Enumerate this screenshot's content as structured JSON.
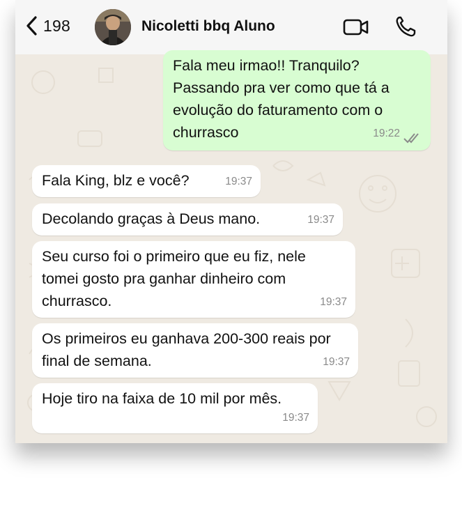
{
  "header": {
    "back_count": "198",
    "contact_name": "Nicoletti bbq Aluno"
  },
  "messages": [
    {
      "direction": "outgoing",
      "text": "Fala meu irmao!! Tranquilo? Passando pra ver como que tá a evolução do faturamento com o churrasco",
      "time": "19:22",
      "status": "read"
    },
    {
      "direction": "incoming",
      "text": "Fala King, blz e você?",
      "time": "19:37"
    },
    {
      "direction": "incoming",
      "text": "Decolando graças à Deus mano.",
      "time": "19:37"
    },
    {
      "direction": "incoming",
      "text": "Seu curso foi o primeiro que eu fiz, nele tomei gosto pra ganhar dinheiro com churrasco.",
      "time": "19:37"
    },
    {
      "direction": "incoming",
      "text": "Os primeiros eu ganhava 200-300 reais por final de semana.",
      "time": "19:37"
    },
    {
      "direction": "incoming",
      "text": "Hoje tiro na faixa de 10 mil por mês.",
      "time": "19:37"
    }
  ],
  "icons": {
    "back": "chevron-left-icon",
    "video": "video-camera-icon",
    "call": "phone-icon",
    "read_status": "double-check-icon"
  },
  "colors": {
    "chat_background": "#efeae2",
    "outgoing_bubble": "#d8fdd2",
    "incoming_bubble": "#ffffff",
    "header_background": "#f6f6f6",
    "timestamp": "#8a8a8a"
  }
}
